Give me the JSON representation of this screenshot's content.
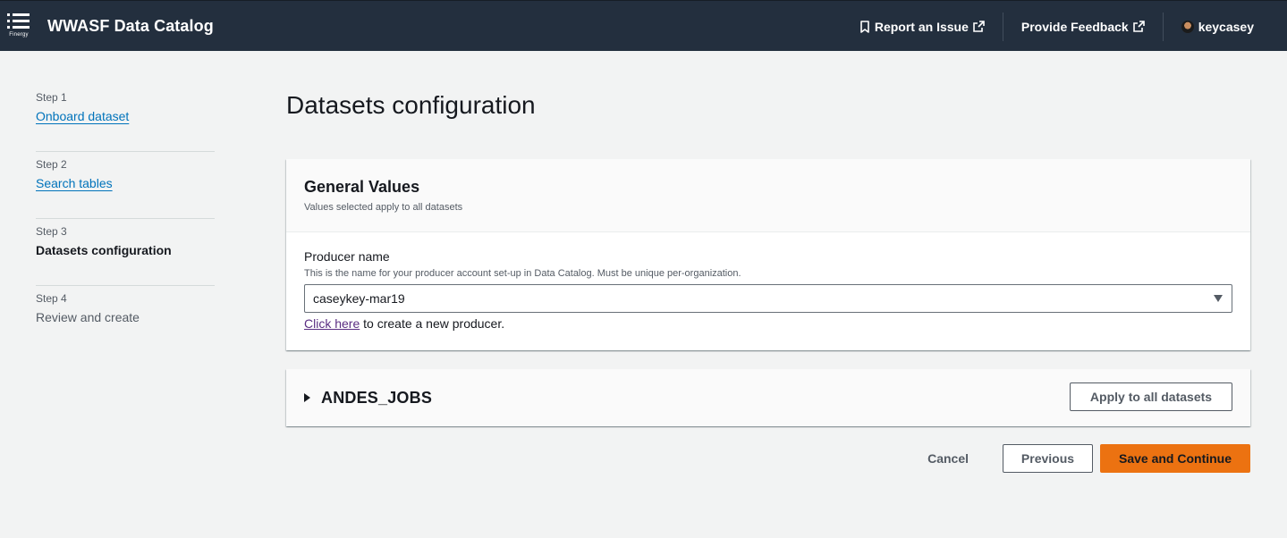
{
  "header": {
    "brand_small": "Finergy",
    "app_title": "WWASF Data Catalog",
    "report_issue": "Report an Issue",
    "provide_feedback": "Provide Feedback",
    "username": "keycasey"
  },
  "steps": [
    {
      "num": "Step 1",
      "label": "Onboard dataset"
    },
    {
      "num": "Step 2",
      "label": "Search tables"
    },
    {
      "num": "Step 3",
      "label": "Datasets configuration"
    },
    {
      "num": "Step 4",
      "label": "Review and create"
    }
  ],
  "main": {
    "page_title": "Datasets configuration",
    "general": {
      "title": "General Values",
      "subtitle": "Values selected apply to all datasets",
      "producer_label": "Producer name",
      "producer_desc": "This is the name for your producer account set-up in Data Catalog. Must be unique per-organization.",
      "producer_value": "caseykey-mar19",
      "create_link": "Click here",
      "create_text": " to create a new producer."
    },
    "dataset": {
      "title": "ANDES_JOBS",
      "apply_button": "Apply to all datasets"
    },
    "actions": {
      "cancel": "Cancel",
      "previous": "Previous",
      "save": "Save and Continue"
    }
  },
  "colors": {
    "header_bg": "#232f3e",
    "link": "#0073bb",
    "primary": "#ec7211",
    "visited_link": "#5a2d82"
  }
}
